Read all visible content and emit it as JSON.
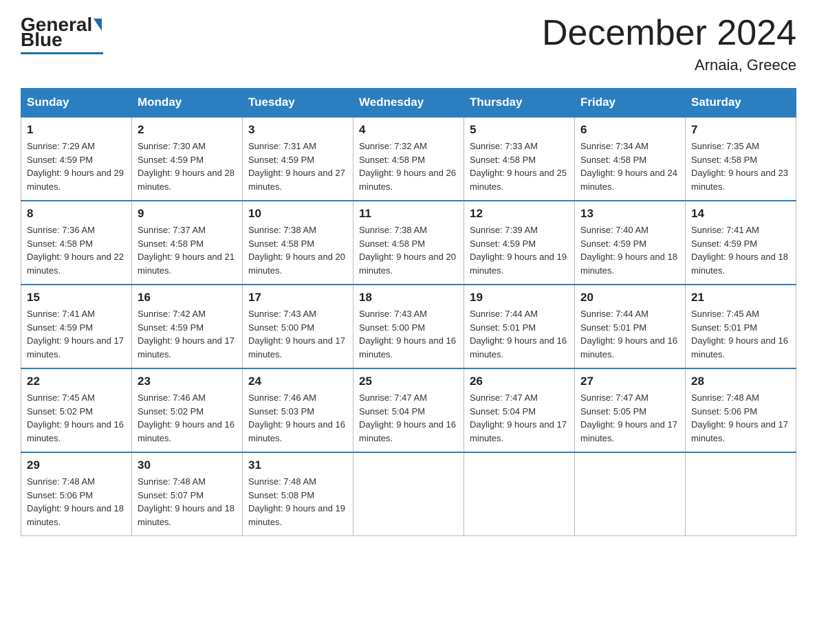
{
  "header": {
    "logo_general": "General",
    "logo_blue": "Blue",
    "month_title": "December 2024",
    "location": "Arnaia, Greece"
  },
  "days_of_week": [
    "Sunday",
    "Monday",
    "Tuesday",
    "Wednesday",
    "Thursday",
    "Friday",
    "Saturday"
  ],
  "weeks": [
    [
      {
        "day": "1",
        "sunrise": "7:29 AM",
        "sunset": "4:59 PM",
        "daylight": "9 hours and 29 minutes."
      },
      {
        "day": "2",
        "sunrise": "7:30 AM",
        "sunset": "4:59 PM",
        "daylight": "9 hours and 28 minutes."
      },
      {
        "day": "3",
        "sunrise": "7:31 AM",
        "sunset": "4:59 PM",
        "daylight": "9 hours and 27 minutes."
      },
      {
        "day": "4",
        "sunrise": "7:32 AM",
        "sunset": "4:58 PM",
        "daylight": "9 hours and 26 minutes."
      },
      {
        "day": "5",
        "sunrise": "7:33 AM",
        "sunset": "4:58 PM",
        "daylight": "9 hours and 25 minutes."
      },
      {
        "day": "6",
        "sunrise": "7:34 AM",
        "sunset": "4:58 PM",
        "daylight": "9 hours and 24 minutes."
      },
      {
        "day": "7",
        "sunrise": "7:35 AM",
        "sunset": "4:58 PM",
        "daylight": "9 hours and 23 minutes."
      }
    ],
    [
      {
        "day": "8",
        "sunrise": "7:36 AM",
        "sunset": "4:58 PM",
        "daylight": "9 hours and 22 minutes."
      },
      {
        "day": "9",
        "sunrise": "7:37 AM",
        "sunset": "4:58 PM",
        "daylight": "9 hours and 21 minutes."
      },
      {
        "day": "10",
        "sunrise": "7:38 AM",
        "sunset": "4:58 PM",
        "daylight": "9 hours and 20 minutes."
      },
      {
        "day": "11",
        "sunrise": "7:38 AM",
        "sunset": "4:58 PM",
        "daylight": "9 hours and 20 minutes."
      },
      {
        "day": "12",
        "sunrise": "7:39 AM",
        "sunset": "4:59 PM",
        "daylight": "9 hours and 19 minutes."
      },
      {
        "day": "13",
        "sunrise": "7:40 AM",
        "sunset": "4:59 PM",
        "daylight": "9 hours and 18 minutes."
      },
      {
        "day": "14",
        "sunrise": "7:41 AM",
        "sunset": "4:59 PM",
        "daylight": "9 hours and 18 minutes."
      }
    ],
    [
      {
        "day": "15",
        "sunrise": "7:41 AM",
        "sunset": "4:59 PM",
        "daylight": "9 hours and 17 minutes."
      },
      {
        "day": "16",
        "sunrise": "7:42 AM",
        "sunset": "4:59 PM",
        "daylight": "9 hours and 17 minutes."
      },
      {
        "day": "17",
        "sunrise": "7:43 AM",
        "sunset": "5:00 PM",
        "daylight": "9 hours and 17 minutes."
      },
      {
        "day": "18",
        "sunrise": "7:43 AM",
        "sunset": "5:00 PM",
        "daylight": "9 hours and 16 minutes."
      },
      {
        "day": "19",
        "sunrise": "7:44 AM",
        "sunset": "5:01 PM",
        "daylight": "9 hours and 16 minutes."
      },
      {
        "day": "20",
        "sunrise": "7:44 AM",
        "sunset": "5:01 PM",
        "daylight": "9 hours and 16 minutes."
      },
      {
        "day": "21",
        "sunrise": "7:45 AM",
        "sunset": "5:01 PM",
        "daylight": "9 hours and 16 minutes."
      }
    ],
    [
      {
        "day": "22",
        "sunrise": "7:45 AM",
        "sunset": "5:02 PM",
        "daylight": "9 hours and 16 minutes."
      },
      {
        "day": "23",
        "sunrise": "7:46 AM",
        "sunset": "5:02 PM",
        "daylight": "9 hours and 16 minutes."
      },
      {
        "day": "24",
        "sunrise": "7:46 AM",
        "sunset": "5:03 PM",
        "daylight": "9 hours and 16 minutes."
      },
      {
        "day": "25",
        "sunrise": "7:47 AM",
        "sunset": "5:04 PM",
        "daylight": "9 hours and 16 minutes."
      },
      {
        "day": "26",
        "sunrise": "7:47 AM",
        "sunset": "5:04 PM",
        "daylight": "9 hours and 17 minutes."
      },
      {
        "day": "27",
        "sunrise": "7:47 AM",
        "sunset": "5:05 PM",
        "daylight": "9 hours and 17 minutes."
      },
      {
        "day": "28",
        "sunrise": "7:48 AM",
        "sunset": "5:06 PM",
        "daylight": "9 hours and 17 minutes."
      }
    ],
    [
      {
        "day": "29",
        "sunrise": "7:48 AM",
        "sunset": "5:06 PM",
        "daylight": "9 hours and 18 minutes."
      },
      {
        "day": "30",
        "sunrise": "7:48 AM",
        "sunset": "5:07 PM",
        "daylight": "9 hours and 18 minutes."
      },
      {
        "day": "31",
        "sunrise": "7:48 AM",
        "sunset": "5:08 PM",
        "daylight": "9 hours and 19 minutes."
      },
      null,
      null,
      null,
      null
    ]
  ]
}
